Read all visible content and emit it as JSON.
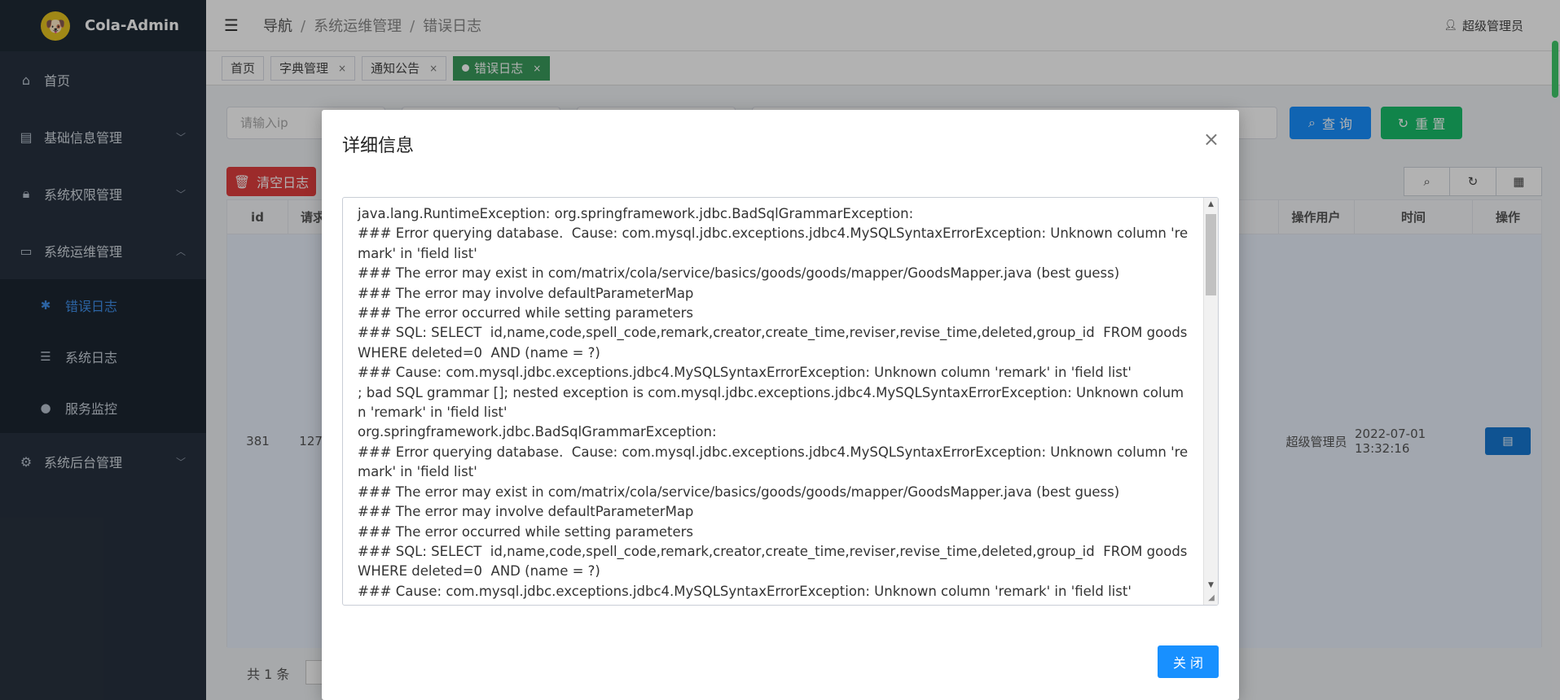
{
  "app": {
    "title": "Cola-Admin"
  },
  "sidebar": {
    "items": [
      {
        "label": "首页",
        "icon": "home-icon"
      },
      {
        "label": "基础信息管理",
        "icon": "document-icon"
      },
      {
        "label": "系统权限管理",
        "icon": "lock-icon"
      },
      {
        "label": "系统运维管理",
        "icon": "briefcase-icon"
      },
      {
        "label": "系统后台管理",
        "icon": "gear-icon"
      }
    ],
    "subitems": [
      {
        "label": "错误日志",
        "icon": "bug-icon",
        "active": true
      },
      {
        "label": "系统日志",
        "icon": "log-icon"
      },
      {
        "label": "服务监控",
        "icon": "monitor-icon"
      }
    ]
  },
  "header": {
    "breadcrumb": [
      "导航",
      "系统运维管理",
      "错误日志"
    ],
    "user": "超级管理员"
  },
  "tabs": [
    {
      "label": "首页"
    },
    {
      "label": "字典管理",
      "closable": true
    },
    {
      "label": "通知公告",
      "closable": true
    },
    {
      "label": "错误日志",
      "closable": true,
      "active": true
    }
  ],
  "search": {
    "ip_placeholder": "请输入ip",
    "query_label": "查 询",
    "reset_label": "重 置",
    "clear_label": "清空日志"
  },
  "table": {
    "columns": [
      "id",
      "请求",
      "操作用户",
      "时间",
      "操作"
    ],
    "rows": [
      {
        "id": "381",
        "request": "127.",
        "user": "超级管理员",
        "time": "2022-07-01 13:32:16"
      }
    ],
    "footer_count": "共 1 条"
  },
  "modal": {
    "title": "详细信息",
    "close_symbol": "×",
    "ok_label": "关 闭",
    "detail_lines": [
      "java.lang.RuntimeException: org.springframework.jdbc.BadSqlGrammarException:",
      "### Error querying database.  Cause: com.mysql.jdbc.exceptions.jdbc4.MySQLSyntaxErrorException: Unknown column 'remark' in 'field list'",
      "### The error may exist in com/matrix/cola/service/basics/goods/goods/mapper/GoodsMapper.java (best guess)",
      "### The error may involve defaultParameterMap",
      "### The error occurred while setting parameters",
      "### SQL: SELECT  id,name,code,spell_code,remark,creator,create_time,reviser,revise_time,deleted,group_id  FROM goods   WHERE deleted=0  AND (name = ?)",
      "### Cause: com.mysql.jdbc.exceptions.jdbc4.MySQLSyntaxErrorException: Unknown column 'remark' in 'field list'",
      "; bad SQL grammar []; nested exception is com.mysql.jdbc.exceptions.jdbc4.MySQLSyntaxErrorException: Unknown column 'remark' in 'field list'",
      "org.springframework.jdbc.BadSqlGrammarException:",
      "### Error querying database.  Cause: com.mysql.jdbc.exceptions.jdbc4.MySQLSyntaxErrorException: Unknown column 'remark' in 'field list'",
      "### The error may exist in com/matrix/cola/service/basics/goods/goods/mapper/GoodsMapper.java (best guess)",
      "### The error may involve defaultParameterMap",
      "### The error occurred while setting parameters",
      "### SQL: SELECT  id,name,code,spell_code,remark,creator,create_time,reviser,revise_time,deleted,group_id  FROM goods   WHERE deleted=0  AND (name = ?)",
      "### Cause: com.mysql.jdbc.exceptions.jdbc4.MySQLSyntaxErrorException: Unknown column 'remark' in 'field list'"
    ]
  },
  "colors": {
    "sidebar_bg": "#28323f",
    "accent": "#1890ff",
    "active_tab": "#3a9b5c",
    "danger": "#e03e3e",
    "success": "#19be6b"
  }
}
